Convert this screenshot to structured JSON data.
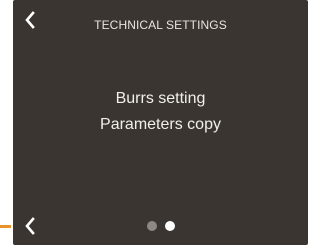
{
  "header": {
    "title": "TECHNICAL SETTINGS"
  },
  "menu": {
    "items": [
      {
        "label": "Burrs setting"
      },
      {
        "label": "Parameters copy"
      }
    ]
  },
  "pagination": {
    "total_pages": 2,
    "current_page": 2
  },
  "icons": {
    "back_top": "chevron-left-icon",
    "back_bottom": "chevron-left-icon"
  },
  "colors": {
    "screen_background": "#3a3530",
    "text": "#f2efeb",
    "dot_inactive": "#8e8984",
    "dot_active": "#ffffff",
    "pointer_accent": "#e8932a"
  }
}
